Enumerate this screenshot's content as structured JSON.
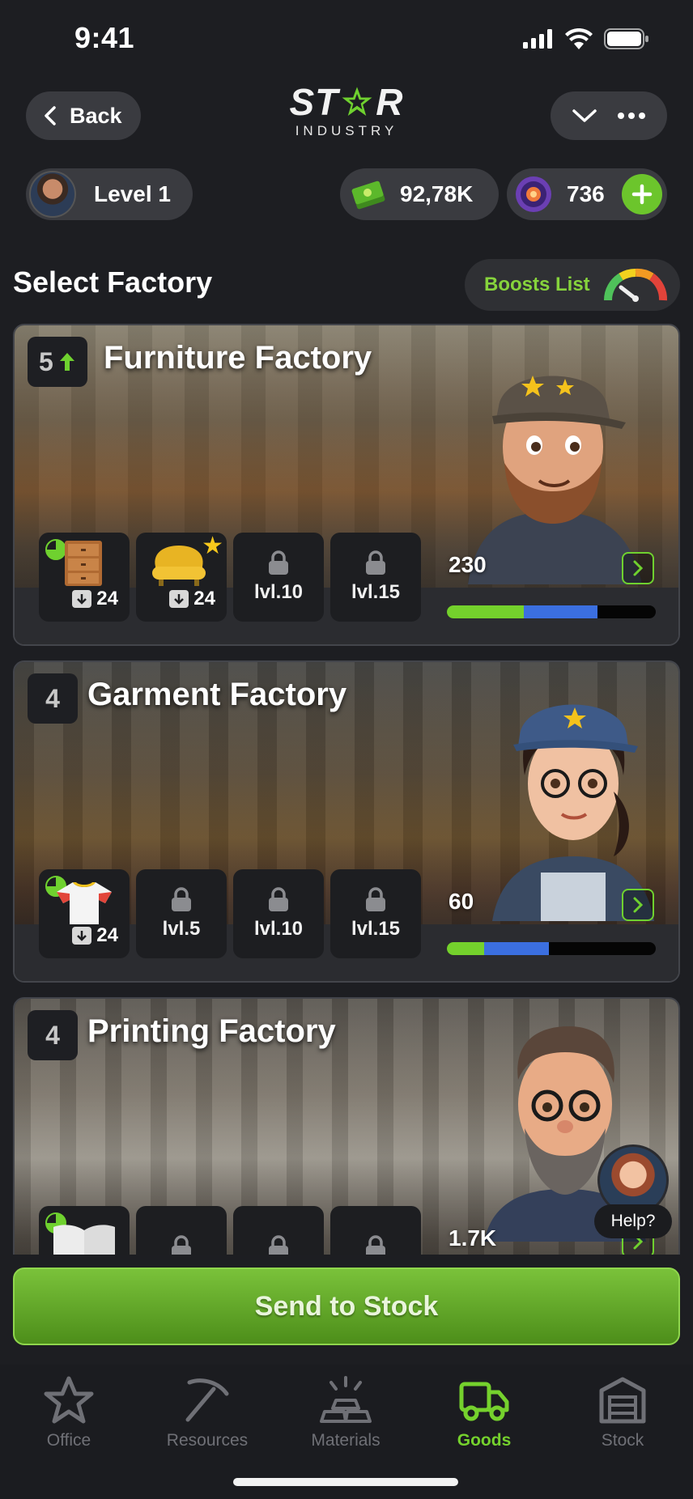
{
  "status_bar": {
    "time": "9:41"
  },
  "header": {
    "back_label": "Back",
    "logo_text_left": "ST",
    "logo_text_right": "R",
    "logo_subtitle": "INDUSTRY"
  },
  "player": {
    "level_label": "Level 1",
    "cash": "92,78K",
    "gems": "736"
  },
  "section": {
    "title": "Select Factory",
    "boosts_label": "Boosts List"
  },
  "factories": [
    {
      "level": "5",
      "name": "Furniture Factory",
      "slots": [
        {
          "item": "cabinet",
          "count": "24"
        },
        {
          "item": "armchair",
          "count": "24"
        },
        {
          "locked_label": "lvl.10"
        },
        {
          "locked_label": "lvl.15"
        }
      ],
      "score": "230",
      "progress": {
        "green": 0.37,
        "blue": 0.35
      }
    },
    {
      "level": "4",
      "name": "Garment Factory",
      "slots": [
        {
          "item": "t-shirt",
          "count": "24"
        },
        {
          "locked_label": "lvl.5"
        },
        {
          "locked_label": "lvl.10"
        },
        {
          "locked_label": "lvl.15"
        }
      ],
      "score": "60",
      "progress": {
        "green": 0.18,
        "blue": 0.31
      }
    },
    {
      "level": "4",
      "name": "Printing Factory",
      "slots": [
        {
          "item": "book"
        },
        {
          "locked_label": ""
        },
        {
          "locked_label": ""
        },
        {
          "locked_label": ""
        }
      ],
      "score": "1.7K"
    }
  ],
  "help": {
    "label": "Help?"
  },
  "send_button": {
    "label": "Send to Stock"
  },
  "tabs": [
    {
      "label": "Office",
      "icon": "star-icon",
      "active": false
    },
    {
      "label": "Resources",
      "icon": "pickaxe-icon",
      "active": false
    },
    {
      "label": "Materials",
      "icon": "gold-bars-icon",
      "active": false
    },
    {
      "label": "Goods",
      "icon": "truck-icon",
      "active": true
    },
    {
      "label": "Stock",
      "icon": "warehouse-icon",
      "active": false
    }
  ],
  "colors": {
    "accent_green": "#75d12d",
    "background": "#1d1e22",
    "progress_blue": "#3b6fe0"
  }
}
